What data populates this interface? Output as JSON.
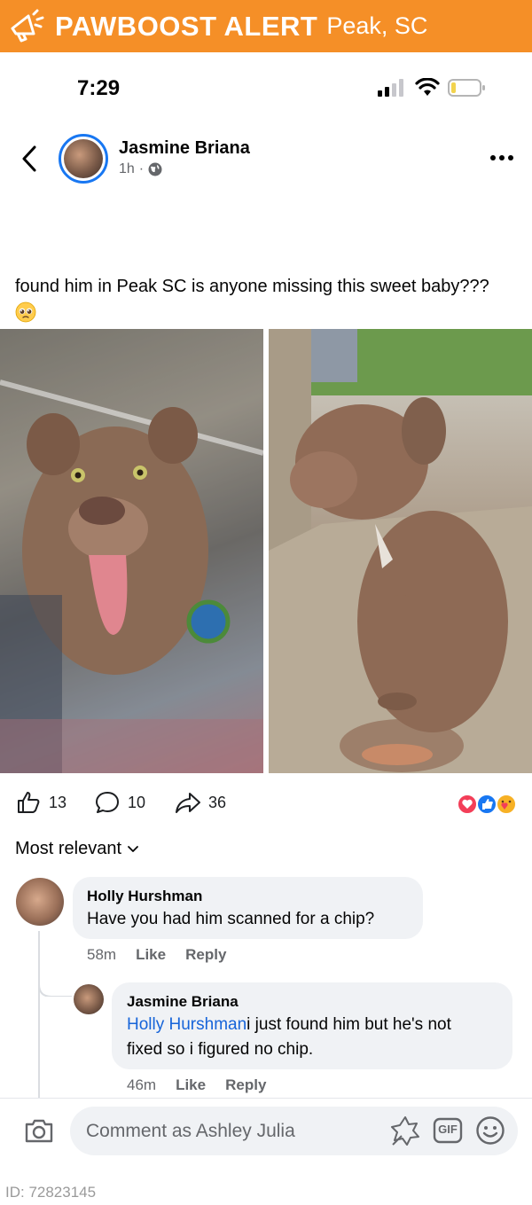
{
  "banner": {
    "brand": "PAWBOOST ALERT",
    "location": "Peak, SC",
    "color": "#f58f27"
  },
  "status_bar": {
    "time": "7:29"
  },
  "post": {
    "author": "Jasmine Briana",
    "age": "1h",
    "separator": "·",
    "text": "found him in Peak SC is anyone missing this sweet baby???",
    "emoji": "pleading-face-emoji",
    "photos": [
      "dog-photo-through-window",
      "dog-photo-on-car-seat"
    ]
  },
  "actions": {
    "likes": "13",
    "comments": "10",
    "shares": "36"
  },
  "reactions": [
    "love",
    "like",
    "care"
  ],
  "sort": {
    "label": "Most relevant"
  },
  "comments": [
    {
      "author": "Holly Hurshman",
      "text": "Have you had him scanned for a chip?",
      "time": "58m",
      "like": "Like",
      "reply": "Reply"
    },
    {
      "author": "Jasmine Briana",
      "mention": "Holly Hurshman",
      "text_line1": "i just found him but he's not",
      "text_line2": "fixed so i figured no chip.",
      "time": "46m",
      "like": "Like",
      "reply": "Reply"
    }
  ],
  "composer": {
    "placeholder": "Comment as Ashley Julia",
    "gif_label": "GIF"
  },
  "footer": {
    "id": "ID: 72823145"
  },
  "colors": {
    "accent": "#1877f2",
    "link": "#1664d9",
    "muted": "#65676b",
    "bubble": "#f0f2f5"
  }
}
